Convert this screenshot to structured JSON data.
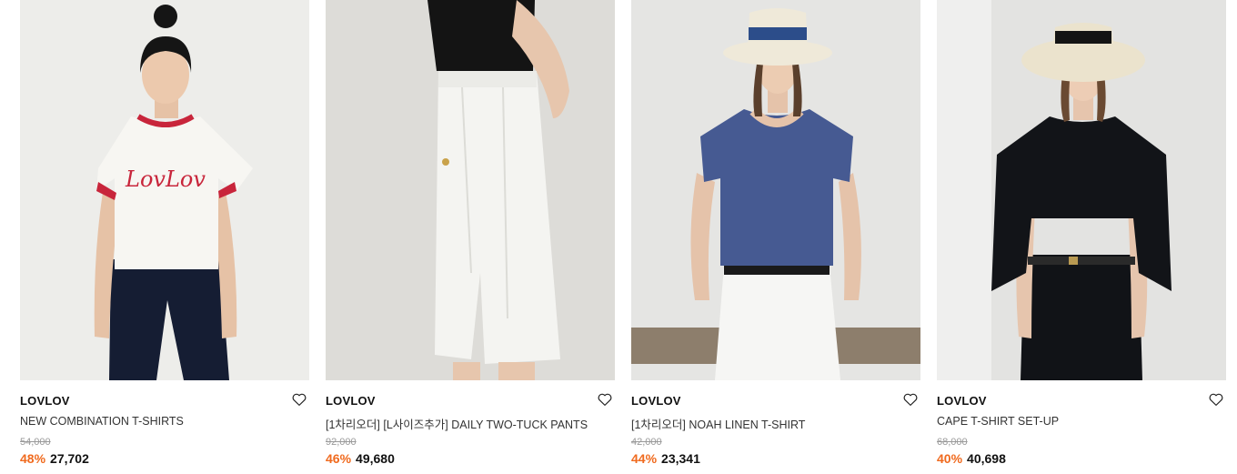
{
  "products": [
    {
      "brand": "LOVLOV",
      "name": "NEW COMBINATION T-SHIRTS",
      "original_price": "54,000",
      "discount": "48%",
      "sale_price": "27,702",
      "image_logo_text": "LovLov"
    },
    {
      "brand": "LOVLOV",
      "name": "[1차리오더] [L사이즈추가] DAILY TWO-TUCK PANTS",
      "original_price": "92,000",
      "discount": "46%",
      "sale_price": "49,680"
    },
    {
      "brand": "LOVLOV",
      "name": "[1차리오더] NOAH LINEN T-SHIRT",
      "original_price": "42,000",
      "discount": "44%",
      "sale_price": "23,341"
    },
    {
      "brand": "LOVLOV",
      "name": "CAPE T-SHIRT SET-UP",
      "original_price": "68,000",
      "discount": "40%",
      "sale_price": "40,698"
    }
  ],
  "icons": {
    "wishlist": "heart-outline-icon"
  },
  "colors": {
    "discount": "#f06a1e",
    "brand_text": "#111111"
  }
}
